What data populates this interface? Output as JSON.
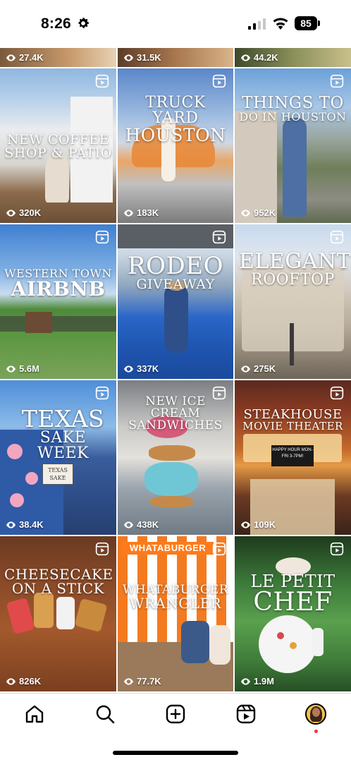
{
  "status_bar": {
    "time": "8:26",
    "battery": "85"
  },
  "grid": {
    "top_row_views": [
      "27.4K",
      "31.5K",
      "44.2K"
    ],
    "tiles": [
      {
        "line1": "NEW COFFEE",
        "line2": "SHOP & PATIO",
        "views": "320K"
      },
      {
        "line1": "TRUCK YARD",
        "line2": "HOUSTON",
        "views": "183K"
      },
      {
        "line1": "THINGS TO",
        "line2": "DO IN HOUSTON",
        "views": "952K"
      },
      {
        "line1": "WESTERN TOWN",
        "line2": "AIRBNB",
        "views": "5.6M"
      },
      {
        "line1": "RODEO",
        "line2": "GIVEAWAY",
        "views": "337K"
      },
      {
        "line1": "ELEGANT",
        "line2": "ROOFTOP",
        "views": "275K"
      },
      {
        "line1": "TEXAS",
        "line2": "SAKE WEEK",
        "views": "38.4K",
        "sign": "TEXAS SAKE"
      },
      {
        "line1": "NEW ICE CREAM",
        "line2": "SANDWICHES",
        "views": "438K"
      },
      {
        "line1": "STEAKHOUSE",
        "line2": "MOVIE THEATER",
        "views": "109K",
        "marquee": "HAPPY HOUR MON-FRI 3-7PM!"
      },
      {
        "line1": "CHEESECAKE",
        "line2": "ON A STICK",
        "views": "826K"
      },
      {
        "line1": "WHATABURGER",
        "line2": "WRANGLER",
        "views": "77.7K",
        "sign": "WHATABURGER"
      },
      {
        "line1": "LE PETIT",
        "line2": "CHEF",
        "views": "1.9M"
      }
    ]
  },
  "nav": {
    "icons": [
      "home-icon",
      "search-icon",
      "create-icon",
      "reels-icon",
      "profile-avatar"
    ]
  },
  "colors": {
    "notification": "#ff3040",
    "avatar_ring": "#f2c14e"
  }
}
